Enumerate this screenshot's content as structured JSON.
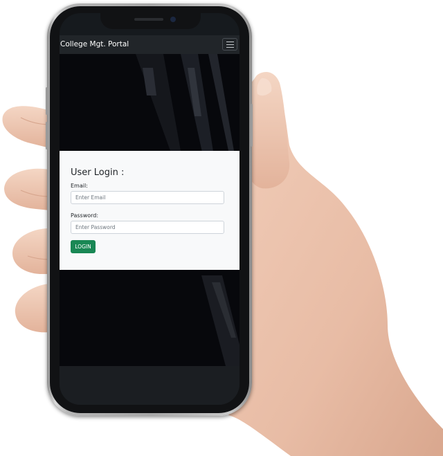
{
  "navbar": {
    "brand": "College Mgt. Portal",
    "menu_icon": "hamburger-menu-icon"
  },
  "login": {
    "title": "User Login :",
    "email_label": "Email:",
    "email_placeholder": "Enter Email",
    "email_value": "",
    "password_label": "Password:",
    "password_placeholder": "Enter Password",
    "password_value": "",
    "submit_label": "LOGIN"
  },
  "colors": {
    "navbar_bg": "#212529",
    "card_bg": "#f8f9fa",
    "button_bg": "#198754",
    "hero_bg": "#07080c"
  }
}
